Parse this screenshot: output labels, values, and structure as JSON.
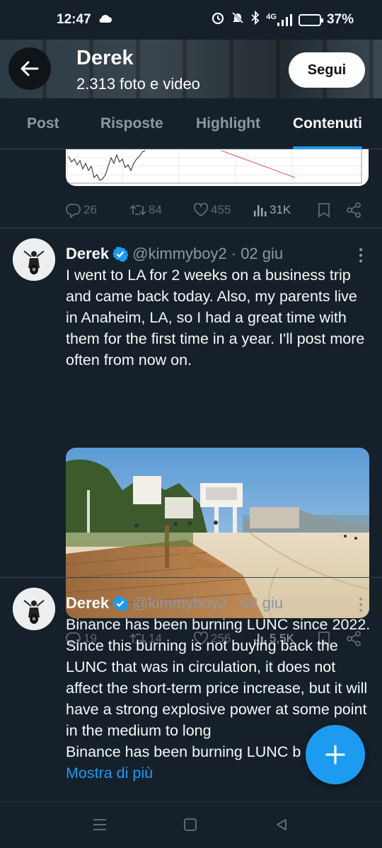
{
  "status": {
    "time": "12:47",
    "network": "4G",
    "battery": "37%",
    "battery_level": 0.37
  },
  "header": {
    "title": "Derek",
    "subtitle": "2.313 foto e video",
    "follow_label": "Segui"
  },
  "tabs": [
    {
      "label": "Post",
      "active": false
    },
    {
      "label": "Risposte",
      "active": false
    },
    {
      "label": "Highlight",
      "active": false
    },
    {
      "label": "Contenuti",
      "active": true
    }
  ],
  "posts": [
    {
      "id": "p0",
      "partial": true,
      "stats": {
        "replies": "26",
        "reposts": "84",
        "likes": "455",
        "views": "31K"
      }
    },
    {
      "id": "p1",
      "author": "Derek",
      "handle": "@kimmyboy2",
      "date": "· 02 giu",
      "text": "I went to LA for 2 weeks on a business trip and came back today. Also, my parents live in Anaheim, LA, so I had a great time with them for the first time in a year. I'll post more often from now on.",
      "stats": {
        "replies": "19",
        "reposts": "14",
        "likes": "256",
        "views": "5,5K"
      }
    },
    {
      "id": "p2",
      "author": "Derek",
      "handle": "@kimmyboy2",
      "date": "· 02 giu",
      "text_lines": [
        "Binance has been burning LUNC since 2022.",
        "Since this burning is not buying back the LUNC that was in circulation, it does not affect the short-term price increase, but it will have a strong explosive power at some point in the medium to long",
        "Binance has been burning LUNC b"
      ],
      "show_more": "Mostra di più"
    }
  ],
  "colors": {
    "background": "#15202b",
    "accent": "#1d9bf0",
    "muted": "#8b98a5",
    "divider": "#38444d"
  }
}
